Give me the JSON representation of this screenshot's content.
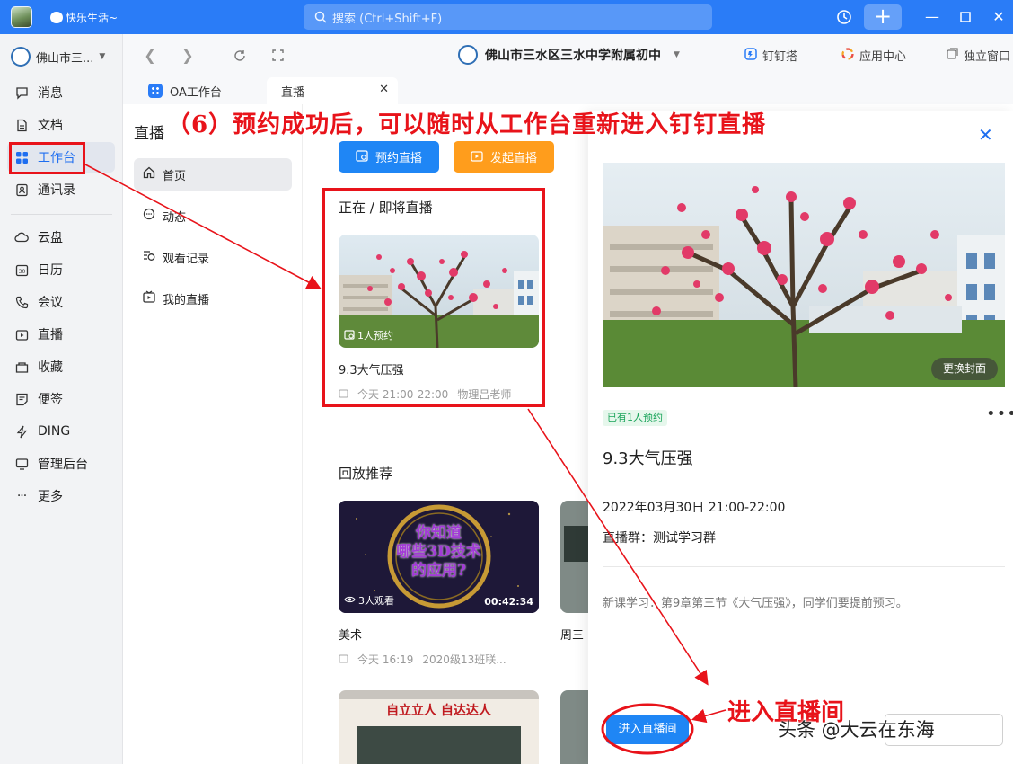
{
  "titlebar": {
    "status": "快乐生活~",
    "search_placeholder": "搜索 (Ctrl+Shift+F)",
    "icons": [
      "history-icon",
      "plus-icon",
      "minimize-icon",
      "maximize-icon",
      "close-icon"
    ]
  },
  "sidebar": {
    "org_name": "佛山市三...",
    "items": [
      {
        "label": "消息",
        "icon": "message-icon"
      },
      {
        "label": "文档",
        "icon": "document-icon"
      },
      {
        "label": "工作台",
        "icon": "workbench-icon"
      },
      {
        "label": "通讯录",
        "icon": "contacts-icon"
      },
      {
        "label": "云盘",
        "icon": "cloud-icon"
      },
      {
        "label": "日历",
        "icon": "calendar-icon"
      },
      {
        "label": "会议",
        "icon": "phone-icon"
      },
      {
        "label": "直播",
        "icon": "live-icon"
      },
      {
        "label": "收藏",
        "icon": "favorite-icon"
      },
      {
        "label": "便签",
        "icon": "note-icon"
      },
      {
        "label": "DING",
        "icon": "ding-icon"
      },
      {
        "label": "管理后台",
        "icon": "admin-icon"
      },
      {
        "label": "更多",
        "icon": "more-icon"
      }
    ]
  },
  "topbar": {
    "school": "佛山市三水区三水中学附属初中",
    "links": [
      "钉钉搭",
      "应用中心",
      "独立窗口"
    ]
  },
  "tabs": [
    {
      "label": "OA工作台"
    },
    {
      "label": "直播"
    }
  ],
  "live": {
    "header": "直播",
    "menu": [
      "首页",
      "动态",
      "观看记录",
      "我的直播"
    ],
    "btn_book": "预约直播",
    "btn_start": "发起直播",
    "annotation": "（6）预约成功后，可以随时从工作台重新进入钉钉直播",
    "now_title": "正在 / 即将直播",
    "now_card": {
      "badge": "1人预约",
      "title": "9.3大气压强",
      "time": "今天 21:00-22:00",
      "teacher": "物理吕老师"
    },
    "replay_title": "回放推荐",
    "replay_cards": [
      {
        "thumb_text_1": "你知道",
        "thumb_text_2": "哪些3D技术",
        "thumb_text_3": "的应用?",
        "views": "3人观看",
        "duration": "00:42:34",
        "title": "美术",
        "time": "今天 16:19",
        "group": "2020级13班联..."
      },
      {
        "title": "周三"
      }
    ],
    "bottom_banner": "自立立人  自达达人"
  },
  "panel": {
    "change_cover": "更换封面",
    "badge": "已有1人预约",
    "title": "9.3大气压强",
    "time": "2022年03月30日 21:00-22:00",
    "group": "直播群：测试学习群",
    "desc": "新课学习：第9章第三节《大气压强》，同学们要提前预习。",
    "enter": "进入直播间",
    "enter_annotation": "进入直播间"
  },
  "watermark": "头条 @大云在东海",
  "colors": {
    "brand_blue": "#2a7cf7",
    "orange": "#ff9d1c",
    "annotation_red": "#e8131a"
  }
}
